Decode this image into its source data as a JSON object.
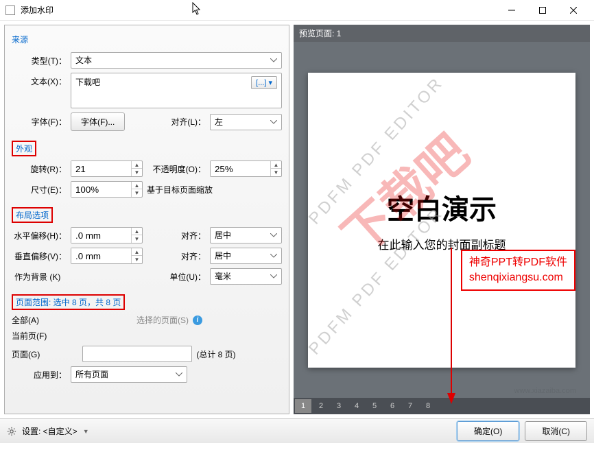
{
  "window": {
    "title": "添加水印"
  },
  "source": {
    "label": "来源",
    "type_label": "类型(T)：",
    "type_value": "文本",
    "text_label": "文本(X)：",
    "text_value": "下载吧",
    "font_label": "字体(F)：",
    "font_btn": "字体(F)...",
    "align_label": "对齐(L)：",
    "align_value": "左"
  },
  "appearance": {
    "label": "外观",
    "rotate_label": "旋转(R)：",
    "rotate_value": "21",
    "opacity_label": "不透明度(O)：",
    "opacity_value": "25%",
    "size_label": "尺寸(E)：",
    "size_value": "100%",
    "size_note": "基于目标页面缩放"
  },
  "layout": {
    "label": "布局选项",
    "hoffset_label": "水平偏移(H)：",
    "hoffset_value": ".0 mm",
    "voffset_label": "垂直偏移(V)：",
    "voffset_value": ".0 mm",
    "align_label": "对齐：",
    "halign_value": "居中",
    "valign_value": "居中",
    "unit_label": "单位(U)：",
    "unit_value": "毫米",
    "bg_label": "作为背景 (K)"
  },
  "range": {
    "label": "页面范围: 选中 8 页，共 8 页",
    "all": "全部(A)",
    "selected": "选择的页面(S)",
    "current": "当前页(F)",
    "pages": "页面(G)",
    "total": "(总计 8 页)",
    "apply_label": "应用到：",
    "apply_value": "所有页面"
  },
  "preview": {
    "header": "预览页面: 1",
    "title": "空白演示",
    "subtitle": "在此输入您的封面副标题",
    "diag1": "PDFM PDF EDITOR",
    "red_wm": "下载吧",
    "ad1": "神奇PPT转PDF软件",
    "ad2": "shenqixiangsu.com",
    "pages": [
      "1",
      "2",
      "3",
      "4",
      "5",
      "6",
      "7",
      "8"
    ]
  },
  "footer": {
    "settings": "设置: <自定义>",
    "ok": "确定(O)",
    "cancel": "取消(C)"
  }
}
